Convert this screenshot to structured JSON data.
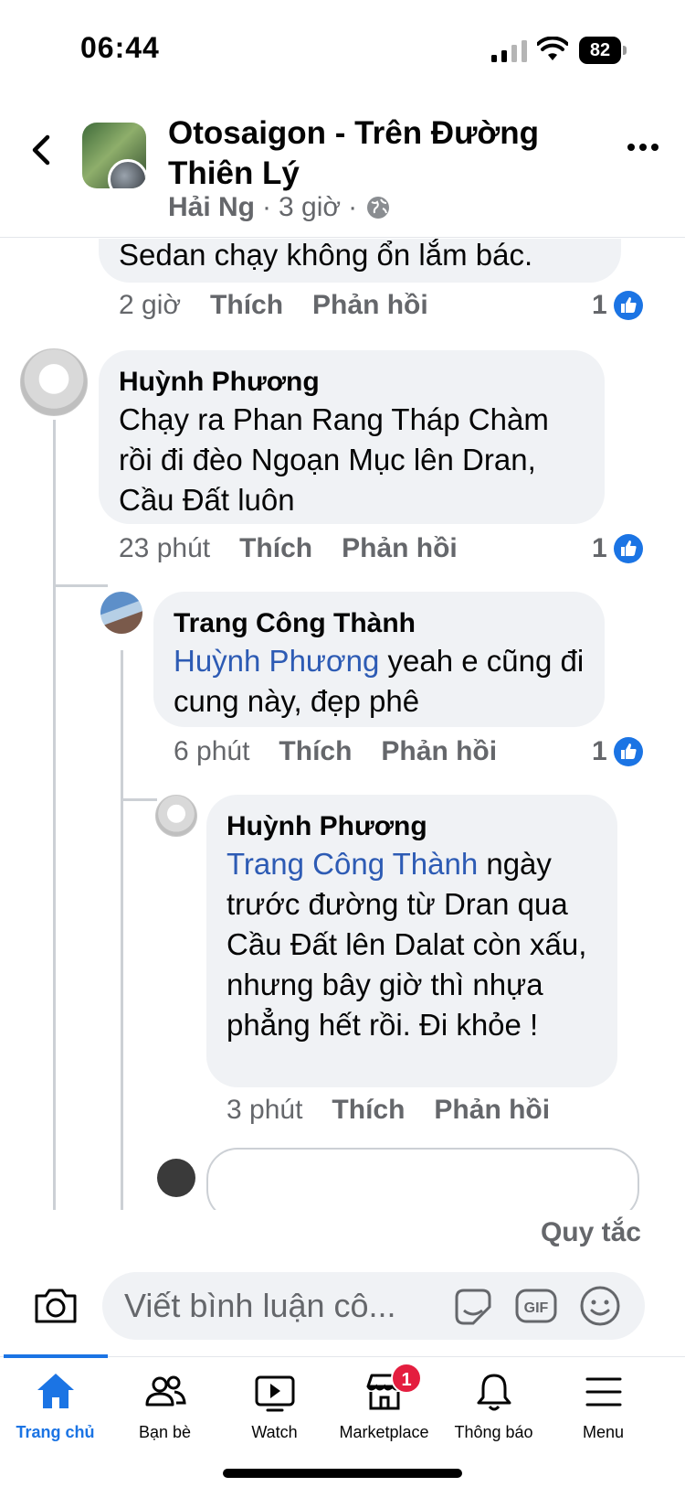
{
  "status_bar": {
    "time": "06:44",
    "battery": "82"
  },
  "header": {
    "title": "Otosaigon - Trên Đường Thiên Lý",
    "author": "Hải Ng",
    "separator": "·",
    "time": "3 giờ",
    "privacy_icon": "globe-icon"
  },
  "comments": [
    {
      "name": "",
      "text": "Sedan chạy không ổn lắm bác.",
      "time": "2 giờ",
      "like_label": "Thích",
      "reply_label": "Phản hồi",
      "reaction_count": "1"
    },
    {
      "name": "Huỳnh Phương",
      "text": "Chạy ra Phan Rang Tháp Chàm rồi đi đèo Ngoạn Mục lên Dran, Cầu Đất luôn",
      "time": "23 phút",
      "like_label": "Thích",
      "reply_label": "Phản hồi",
      "reaction_count": "1"
    },
    {
      "name": "Trang Công Thành",
      "mention": "Huỳnh Phương",
      "text": " yeah e cũng đi cung này, đẹp phê",
      "time": "6 phút",
      "like_label": "Thích",
      "reply_label": "Phản hồi",
      "reaction_count": "1"
    },
    {
      "name": "Huỳnh Phương",
      "mention": "Trang Công Thành",
      "text": " ngày trước đường từ Dran qua Cầu Đất lên Dalat còn xấu, nhưng bây giờ thì nhựa phẳng hết rồi. Đi khỏe !",
      "time": "3 phút",
      "like_label": "Thích",
      "reply_label": "Phản hồi"
    }
  ],
  "composer": {
    "rules_label": "Quy tắc",
    "placeholder": "Viết bình luận cô..."
  },
  "tabbar": {
    "items": [
      {
        "label": "Trang chủ",
        "icon": "home-icon",
        "active": true
      },
      {
        "label": "Bạn bè",
        "icon": "friends-icon"
      },
      {
        "label": "Watch",
        "icon": "watch-icon"
      },
      {
        "label": "Marketplace",
        "icon": "marketplace-icon",
        "badge": "1"
      },
      {
        "label": "Thông báo",
        "icon": "bell-icon"
      },
      {
        "label": "Menu",
        "icon": "menu-icon"
      }
    ]
  },
  "colors": {
    "accent": "#1b74e4",
    "mention": "#2d5bb4",
    "bubble": "#f0f2f5",
    "badge": "#e41e3f"
  }
}
